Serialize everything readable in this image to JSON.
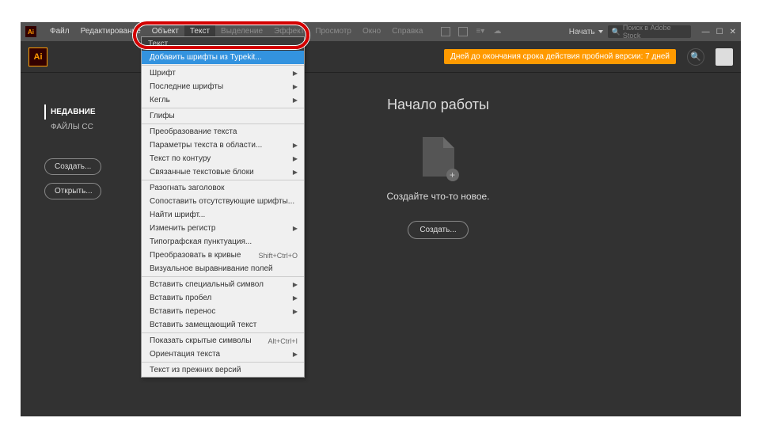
{
  "menu": {
    "items": [
      "Файл",
      "Редактирование",
      "Объект",
      "Текст",
      "Выделение",
      "Эффект",
      "Просмотр",
      "Окно",
      "Справка"
    ],
    "start": "Начать",
    "search_placeholder": "Поиск в Adobe Stock"
  },
  "trial": "Дней до окончания срока действия пробной версии: 7 дней",
  "sidebar": {
    "recent": "НЕДАВНИЕ",
    "cc": "ФАЙЛЫ CC",
    "create": "Создать...",
    "open": "Открыть..."
  },
  "content": {
    "title": "Начало работы",
    "subtitle": "Создайте что-то новое.",
    "create": "Создать..."
  },
  "dropdown": {
    "head": "Текст",
    "items": [
      {
        "label": "Добавить шрифты из Typekit...",
        "type": "hl"
      },
      {
        "type": "sep"
      },
      {
        "label": "Шрифт",
        "arrow": true
      },
      {
        "label": "Последние шрифты",
        "arrow": true
      },
      {
        "label": "Кегль",
        "arrow": true
      },
      {
        "type": "sep"
      },
      {
        "label": "Глифы"
      },
      {
        "type": "sep"
      },
      {
        "label": "Преобразование текста"
      },
      {
        "label": "Параметры текста в области...",
        "arrow": true
      },
      {
        "label": "Текст по контуру",
        "arrow": true
      },
      {
        "label": "Связанные текстовые блоки",
        "arrow": true
      },
      {
        "type": "sep"
      },
      {
        "label": "Разогнать заголовок"
      },
      {
        "label": "Сопоставить отсутствующие шрифты..."
      },
      {
        "label": "Найти шрифт..."
      },
      {
        "label": "Изменить регистр",
        "arrow": true
      },
      {
        "label": "Типографская пунктуация..."
      },
      {
        "label": "Преобразовать в кривые",
        "shortcut": "Shift+Ctrl+O"
      },
      {
        "label": "Визуальное выравнивание полей"
      },
      {
        "type": "sep"
      },
      {
        "label": "Вставить специальный символ",
        "arrow": true
      },
      {
        "label": "Вставить пробел",
        "arrow": true
      },
      {
        "label": "Вставить перенос",
        "arrow": true
      },
      {
        "label": "Вставить замещающий текст"
      },
      {
        "type": "sep"
      },
      {
        "label": "Показать скрытые символы",
        "shortcut": "Alt+Ctrl+I"
      },
      {
        "label": "Ориентация текста",
        "arrow": true
      },
      {
        "type": "sep"
      },
      {
        "label": "Текст из прежних версий"
      }
    ]
  }
}
